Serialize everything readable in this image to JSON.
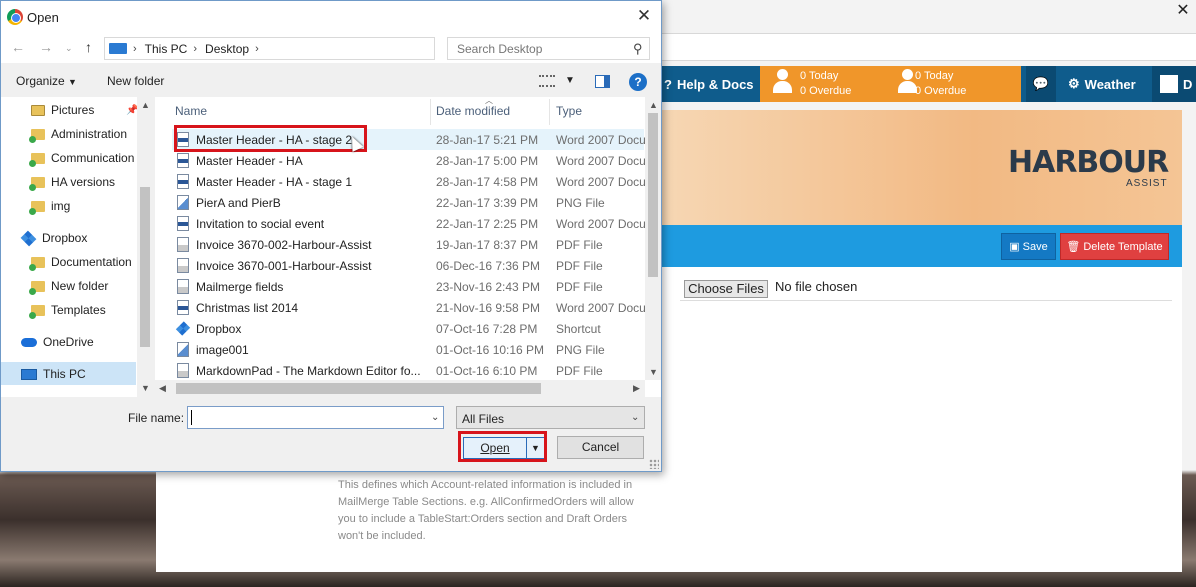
{
  "background_app": {
    "nav": {
      "help_label": "Help & Docs",
      "widget1": {
        "today": "0 Today",
        "overdue": "0 Overdue"
      },
      "widget2": {
        "today": "0 Today",
        "overdue": "0 Overdue"
      },
      "weather_label": "Weather",
      "trailing_letter": "D"
    },
    "logo_main": "HARBOUR",
    "logo_sub": "ASSIST",
    "save_label": "Save",
    "delete_label": "Delete Template",
    "choose_files_label": "Choose Files",
    "no_file_text": "No file chosen",
    "help_text": "This defines which Account-related information is included in MailMerge Table Sections. e.g. AllConfirmedOrders will allow you to include a TableStart:Orders section and Draft Orders won't be included."
  },
  "dialog": {
    "title": "Open",
    "breadcrumb": [
      "This PC",
      "Desktop"
    ],
    "search_placeholder": "Search Desktop",
    "toolbar": {
      "organize_label": "Organize",
      "new_folder_label": "New folder"
    },
    "nav_items": [
      "Pictures",
      "Administration",
      "Communication",
      "HA versions",
      "img",
      "Dropbox",
      "Documentation",
      "New folder",
      "Templates",
      "OneDrive",
      "This PC"
    ],
    "columns": {
      "name": "Name",
      "date": "Date modified",
      "type": "Type"
    },
    "files": [
      {
        "name": "Master Header - HA - stage 2",
        "date": "28-Jan-17 5:21 PM",
        "type": "Word 2007 Docu..."
      },
      {
        "name": "Master Header - HA",
        "date": "28-Jan-17 5:00 PM",
        "type": "Word 2007 Docu..."
      },
      {
        "name": "Master Header - HA - stage 1",
        "date": "28-Jan-17 4:58 PM",
        "type": "Word 2007 Docu..."
      },
      {
        "name": "PierA and PierB",
        "date": "22-Jan-17 3:39 PM",
        "type": "PNG File"
      },
      {
        "name": "Invitation to social event",
        "date": "22-Jan-17 2:25 PM",
        "type": "Word 2007 Docu..."
      },
      {
        "name": "Invoice 3670-002-Harbour-Assist",
        "date": "19-Jan-17 8:37 PM",
        "type": "PDF File"
      },
      {
        "name": "Invoice 3670-001-Harbour-Assist",
        "date": "06-Dec-16 7:36 PM",
        "type": "PDF File"
      },
      {
        "name": "Mailmerge fields",
        "date": "23-Nov-16 2:43 PM",
        "type": "PDF File"
      },
      {
        "name": "Christmas list 2014",
        "date": "21-Nov-16 9:58 PM",
        "type": "Word 2007 Docu..."
      },
      {
        "name": "Dropbox",
        "date": "07-Oct-16 7:28 PM",
        "type": "Shortcut"
      },
      {
        "name": "image001",
        "date": "01-Oct-16 10:16 PM",
        "type": "PNG File"
      },
      {
        "name": "MarkdownPad - The Markdown Editor fo...",
        "date": "01-Oct-16 6:10 PM",
        "type": "PDF File"
      }
    ],
    "file_name_label": "File name:",
    "file_name_value": "",
    "file_type_value": "All Files",
    "open_label": "Open",
    "cancel_label": "Cancel"
  },
  "colors": {
    "highlight": "#d7141b",
    "nav_blue": "#0f5c8c",
    "accent_orange": "#f0962a",
    "save_blue": "#1479c4",
    "delete_red": "#e04040"
  }
}
